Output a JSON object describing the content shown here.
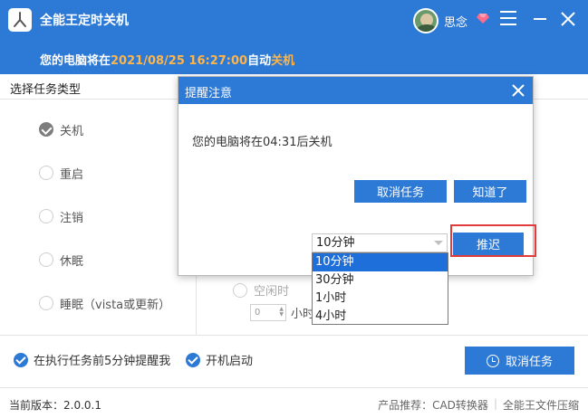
{
  "window": {
    "title": "全能王定时关机",
    "username": "思念",
    "schedule": {
      "prefix": "您的电脑将在",
      "datetime": "2021/08/25 16:27:00",
      "middle": "自动",
      "action": "关机"
    },
    "icons": {
      "logo": "app-logo-icon",
      "vip": "diamond-icon",
      "menu": "menu-icon",
      "minimize": "minimize-icon",
      "close": "close-icon"
    },
    "accent": "#2c79d6",
    "highlight": "#ffb547"
  },
  "task_panel": {
    "header": "选择任务类型",
    "items": [
      {
        "label": "关机",
        "checked": true
      },
      {
        "label": "重启",
        "checked": false
      },
      {
        "label": "注销",
        "checked": false
      },
      {
        "label": "休眠",
        "checked": false
      },
      {
        "label": "睡眠（vista或更新）",
        "checked": false
      }
    ]
  },
  "time_panel": {
    "idle_label": "空闲时",
    "spin_value": "0",
    "spin_unit": "小时"
  },
  "options": {
    "remind_label": "在执行任务前5分钟提醒我",
    "startup_label": "开机启动",
    "cancel_task_button": "取消任务"
  },
  "statusbar": {
    "version": "当前版本：2.0.0.1",
    "recommend": "产品推荐：CAD转换器",
    "product2": "全能王文件压缩"
  },
  "dialog": {
    "title": "提醒注意",
    "message": "您的电脑将在04:31后关机",
    "cancel_button": "取消任务",
    "ok_button": "知道了",
    "postpone_button": "推迟",
    "postpone_selected": "10分钟",
    "postpone_options": [
      "10分钟",
      "30分钟",
      "1小时",
      "4小时"
    ],
    "highlight_color": "#e23b3b"
  }
}
